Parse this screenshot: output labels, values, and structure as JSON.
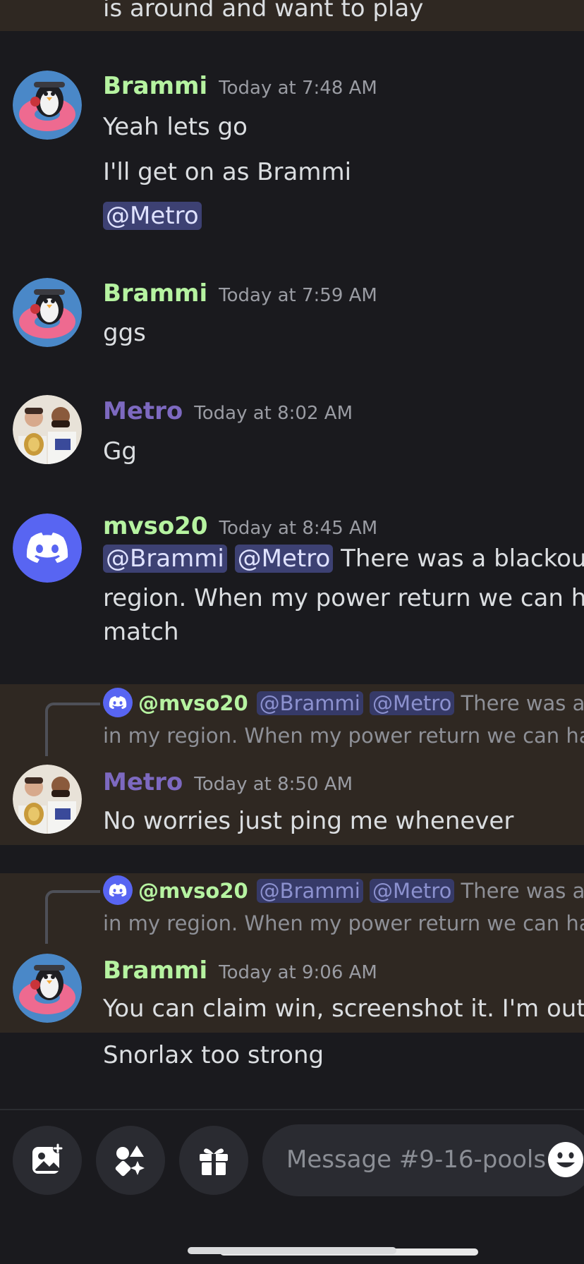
{
  "top_message": {
    "text": "is around and want to play"
  },
  "messages": [
    {
      "username": "Brammi",
      "timestamp": "Today at 7:48 AM",
      "lines": [
        "Yeah lets go",
        "I'll get on as Brammi"
      ],
      "mention": "@Metro"
    },
    {
      "username": "Brammi",
      "timestamp": "Today at 7:59 AM",
      "text": "ggs"
    },
    {
      "username": "Metro",
      "timestamp": "Today at 8:02 AM",
      "text": "Gg"
    },
    {
      "username": "mvso20",
      "timestamp": "Today at 8:45 AM",
      "mentions": [
        "@Brammi",
        "@Metro"
      ],
      "text_line1": "There was a blackout",
      "text_line2": "region. When my power return we can hav",
      "text_line3": "match"
    },
    {
      "reply": {
        "username": "@mvso20",
        "mentions": [
          "@Brammi",
          "@Metro"
        ],
        "text_line1": "There was a b",
        "text_line2": "in my region. When my power return we can hav"
      },
      "username": "Metro",
      "timestamp": "Today at 8:50 AM",
      "text": "No worries just ping me whenever"
    },
    {
      "reply": {
        "username": "@mvso20",
        "mentions": [
          "@Brammi",
          "@Metro"
        ],
        "text_line1": "There was a b",
        "text_line2": "in my region. When my power return we can hav"
      },
      "username": "Brammi",
      "timestamp": "Today at 9:06 AM",
      "text": "You can claim win, screenshot it. I'm out.",
      "text2": "Snorlax too strong"
    }
  ],
  "composer": {
    "placeholder": "Message #9-16-pools",
    "buttons": [
      "image-icon",
      "apps-icon",
      "gift-icon",
      "emoji-icon"
    ]
  },
  "colors": {
    "background": "#1a1a1e",
    "highlight": "#2f2822",
    "brammi_name": "#b6f3a1",
    "metro_name": "#7d69c0",
    "mention_bg": "#3d4173",
    "blurple": "#5865f2"
  }
}
